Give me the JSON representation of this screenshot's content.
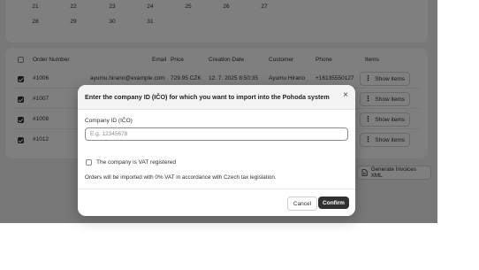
{
  "calendar": {
    "days": [
      "21",
      "22",
      "23",
      "24",
      "25",
      "26",
      "27",
      "28",
      "29",
      "30",
      "31"
    ]
  },
  "orders": {
    "columns": {
      "order_number": "Order Number",
      "email": "Email",
      "price": "Price",
      "creation_date": "Creation Date",
      "customer": "Customer",
      "phone": "Phone",
      "items": "Items"
    },
    "rows": [
      {
        "order_number": "#1006",
        "email": "ayumu.hirano@example.com",
        "price": "729.95 CZK",
        "creation_date": "12. 7. 2025 8:50:35",
        "customer": "Ayumu Hirano",
        "phone": "+16135550127",
        "items_button": "Show items"
      },
      {
        "order_number": "#1007",
        "items_button": "Show items"
      },
      {
        "order_number": "#1008",
        "items_button": "Show items"
      },
      {
        "order_number": "#1012",
        "items_button": "Show items"
      }
    ],
    "generate_button": "Generate Invoices XML"
  },
  "modal": {
    "title": "Enter the company ID (IČO) for which you want to import into the Pohoda system",
    "close_glyph": "×",
    "company_id_label": "Company ID (IČO)",
    "company_id_value": "",
    "company_id_placeholder": "E.g. 12345678",
    "vat_checkbox_label": "The company is VAT registered",
    "vat_checked": false,
    "vat_note": "Orders will be imported with 0% VAT in accordance with Czech tax legislation.",
    "cancel_label": "Cancel",
    "confirm_label": "Confirm"
  },
  "icons": {
    "kebab": "more-vertical-icon",
    "document": "document-icon",
    "close": "close-icon"
  },
  "colors": {
    "primary_button": "#303030",
    "overlay": "rgba(0,0,0,0.5)"
  }
}
